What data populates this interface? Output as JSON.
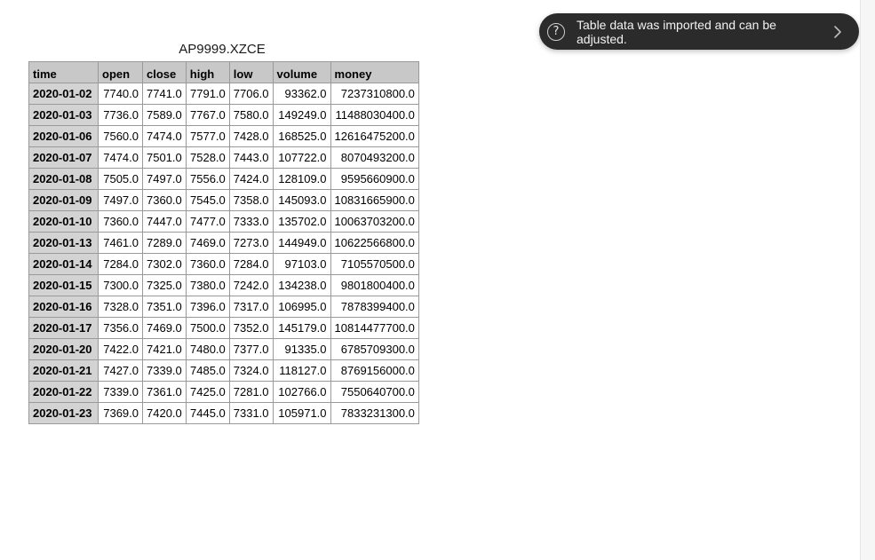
{
  "notification": {
    "help_icon": "question-circle-icon",
    "help_glyph": "?",
    "message": "Table data was imported and can be adjusted.",
    "chevron_icon": "chevron-right-icon"
  },
  "table": {
    "title": "AP9999.XZCE",
    "columns": [
      "time",
      "open",
      "close",
      "high",
      "low",
      "volume",
      "money"
    ],
    "rows": [
      [
        "2020-01-02",
        "7740.0",
        "7741.0",
        "7791.0",
        "7706.0",
        "93362.0",
        "7237310800.0"
      ],
      [
        "2020-01-03",
        "7736.0",
        "7589.0",
        "7767.0",
        "7580.0",
        "149249.0",
        "11488030400.0"
      ],
      [
        "2020-01-06",
        "7560.0",
        "7474.0",
        "7577.0",
        "7428.0",
        "168525.0",
        "12616475200.0"
      ],
      [
        "2020-01-07",
        "7474.0",
        "7501.0",
        "7528.0",
        "7443.0",
        "107722.0",
        "8070493200.0"
      ],
      [
        "2020-01-08",
        "7505.0",
        "7497.0",
        "7556.0",
        "7424.0",
        "128109.0",
        "9595660900.0"
      ],
      [
        "2020-01-09",
        "7497.0",
        "7360.0",
        "7545.0",
        "7358.0",
        "145093.0",
        "10831665900.0"
      ],
      [
        "2020-01-10",
        "7360.0",
        "7447.0",
        "7477.0",
        "7333.0",
        "135702.0",
        "10063703200.0"
      ],
      [
        "2020-01-13",
        "7461.0",
        "7289.0",
        "7469.0",
        "7273.0",
        "144949.0",
        "10622566800.0"
      ],
      [
        "2020-01-14",
        "7284.0",
        "7302.0",
        "7360.0",
        "7284.0",
        "97103.0",
        "7105570500.0"
      ],
      [
        "2020-01-15",
        "7300.0",
        "7325.0",
        "7380.0",
        "7242.0",
        "134238.0",
        "9801800400.0"
      ],
      [
        "2020-01-16",
        "7328.0",
        "7351.0",
        "7396.0",
        "7317.0",
        "106995.0",
        "7878399400.0"
      ],
      [
        "2020-01-17",
        "7356.0",
        "7469.0",
        "7500.0",
        "7352.0",
        "145179.0",
        "10814477700.0"
      ],
      [
        "2020-01-20",
        "7422.0",
        "7421.0",
        "7480.0",
        "7377.0",
        "91335.0",
        "6785709300.0"
      ],
      [
        "2020-01-21",
        "7427.0",
        "7339.0",
        "7485.0",
        "7324.0",
        "118127.0",
        "8769156000.0"
      ],
      [
        "2020-01-22",
        "7339.0",
        "7361.0",
        "7425.0",
        "7281.0",
        "102766.0",
        "7550640700.0"
      ],
      [
        "2020-01-23",
        "7369.0",
        "7420.0",
        "7445.0",
        "7331.0",
        "105971.0",
        "7833231300.0"
      ]
    ]
  },
  "colors": {
    "header_bg": "#c8c8c8",
    "index_bg": "#d3d3d3",
    "toast_bg": "#2b2b2b"
  }
}
